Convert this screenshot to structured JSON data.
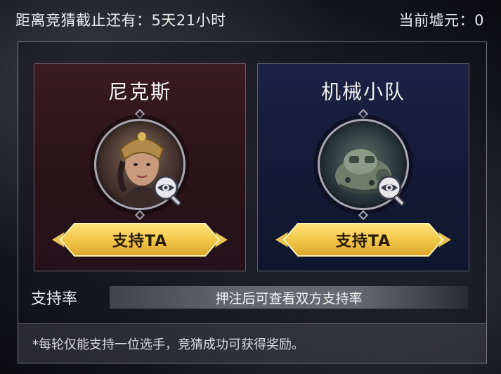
{
  "header": {
    "deadline_label": "距离竞猜截止还有：",
    "deadline_value": "5天21小时",
    "currency_label": "当前墟元：",
    "currency_value": "0"
  },
  "teams": [
    {
      "name": "尼克斯",
      "support_label": "支持TA",
      "avatar_icon": "character-portrait-icon",
      "view_icon": "eye-magnifier-icon",
      "theme": "#3a1b22"
    },
    {
      "name": "机械小队",
      "support_label": "支持TA",
      "avatar_icon": "mech-portrait-icon",
      "view_icon": "eye-magnifier-icon",
      "theme": "#1b2244"
    }
  ],
  "support_rate": {
    "label": "支持率",
    "hint": "押注后可查看双方支持率"
  },
  "notice": "*每轮仅能支持一位选手，竞猜成功可获得奖励。",
  "colors": {
    "button_gold": "#f2c84a",
    "button_text": "#2a1a08",
    "card_red": "#3a1b22",
    "card_blue": "#1b2244"
  }
}
